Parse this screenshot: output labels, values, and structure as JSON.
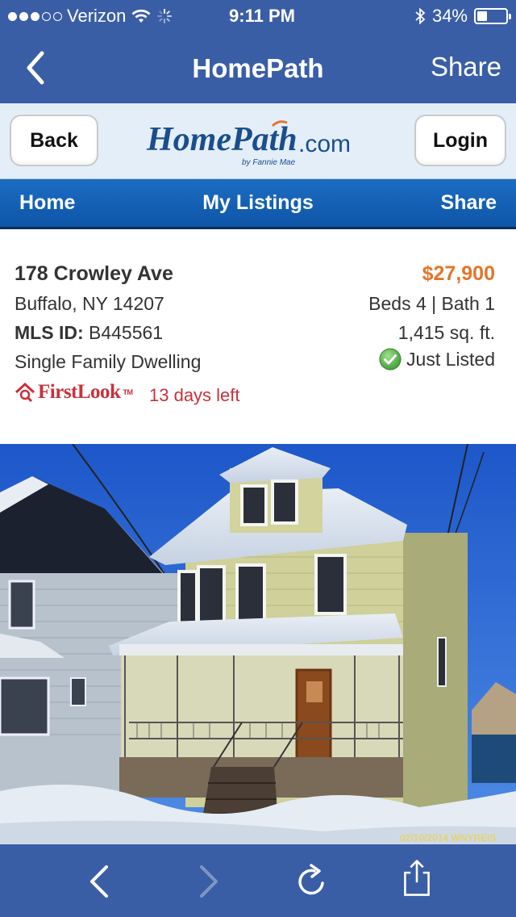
{
  "status_bar": {
    "carrier": "Verizon",
    "time": "9:11 PM",
    "battery": "34%",
    "battery_level": 0.34,
    "signal_bars": 3,
    "signal_total": 5,
    "icons": [
      "wifi-icon",
      "activity-spinner-icon",
      "bluetooth-icon",
      "battery-icon"
    ]
  },
  "nav_bar": {
    "title": "HomePath",
    "share_label": "Share"
  },
  "site_header": {
    "back_label": "Back",
    "login_label": "Login",
    "logo_main": "HomePath",
    "logo_domain": ".com",
    "logo_tagline": "by Fannie Mae"
  },
  "menu": {
    "home": "Home",
    "my_listings": "My Listings",
    "share": "Share"
  },
  "listing": {
    "address": "178 Crowley Ave",
    "city": "Buffalo, NY 14207",
    "mls_label": "MLS ID:",
    "mls_value": "B445561",
    "property_type": "Single Family Dwelling",
    "firstlook_logo": "FirstLook",
    "firstlook_tm": "TM",
    "days_left": "13 days left",
    "price": "$27,900",
    "beds_baths": "Beds 4 | Bath 1",
    "sqft": "1,415 sq. ft.",
    "status": "Just Listed"
  },
  "photo": {
    "watermark": "02/10/2014 WNYREIS"
  },
  "colors": {
    "ios_bar": "#3a5ea6",
    "menu_blue": "#1565b8",
    "price_orange": "#e4752a",
    "firstlook_red": "#c8313a",
    "check_green": "#4caf50"
  }
}
